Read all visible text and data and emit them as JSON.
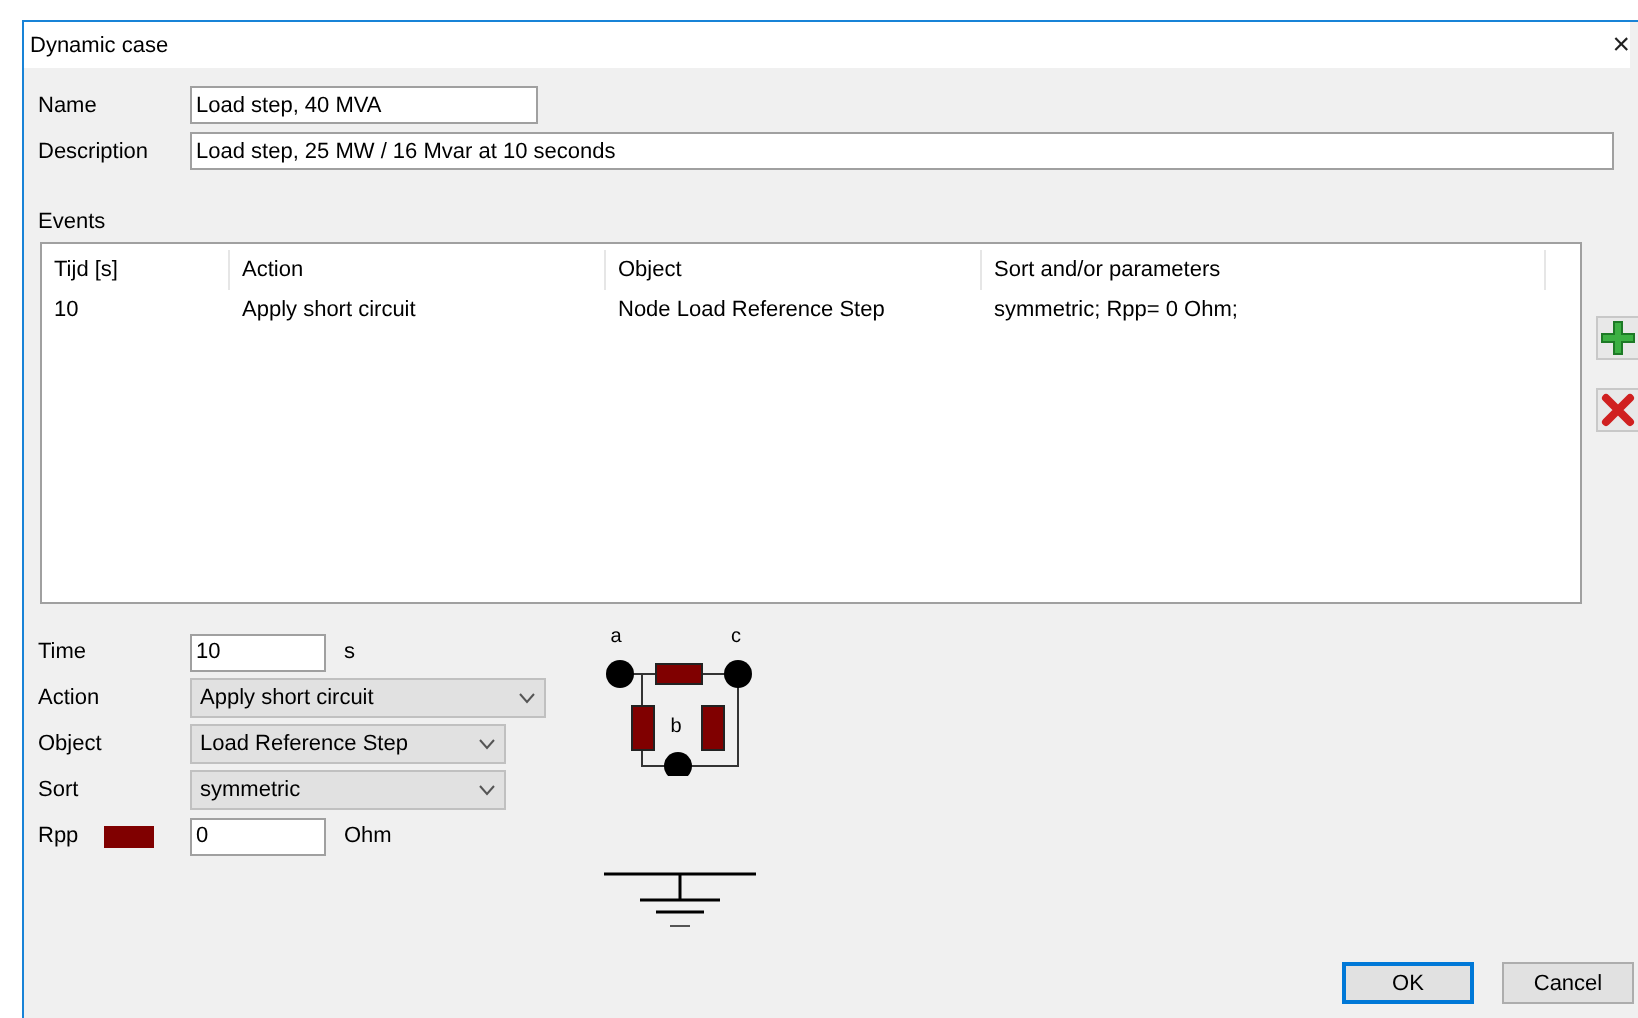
{
  "window": {
    "title": "Dynamic case",
    "close": "×"
  },
  "fields": [
    {
      "label": "Name",
      "value": "Load step, 40 MVA"
    },
    {
      "label": "Description",
      "value": "Load step, 25 MW / 16 Mvar at 10 seconds"
    }
  ],
  "events": {
    "label": "Events",
    "columns": [
      "Tijd [s]",
      "Action",
      "Object",
      "Sort and/or parameters"
    ],
    "rows": [
      {
        "cells": [
          "10",
          "Apply short circuit",
          "Node Load Reference Step",
          "symmetric; Rpp= 0 Ohm;"
        ],
        "selected": false
      }
    ]
  },
  "parameters": [
    {
      "kind": "text",
      "label": "Time",
      "value": "10",
      "unit": "s"
    },
    {
      "kind": "dropdown",
      "label": "Action",
      "value": "Apply short circuit"
    },
    {
      "kind": "dropdown",
      "label": "Object",
      "value": "Load Reference Step"
    },
    {
      "kind": "dropdown",
      "label": "Sort",
      "value": "symmetric"
    },
    {
      "kind": "resistance",
      "label": "Rpp",
      "value": "0",
      "unit": "Ohm"
    }
  ],
  "diagram": {
    "node_labels": [
      "a",
      "c",
      "b"
    ]
  },
  "buttons": [
    {
      "label": "OK",
      "default": true
    },
    {
      "label": "Cancel",
      "default": false
    }
  ]
}
